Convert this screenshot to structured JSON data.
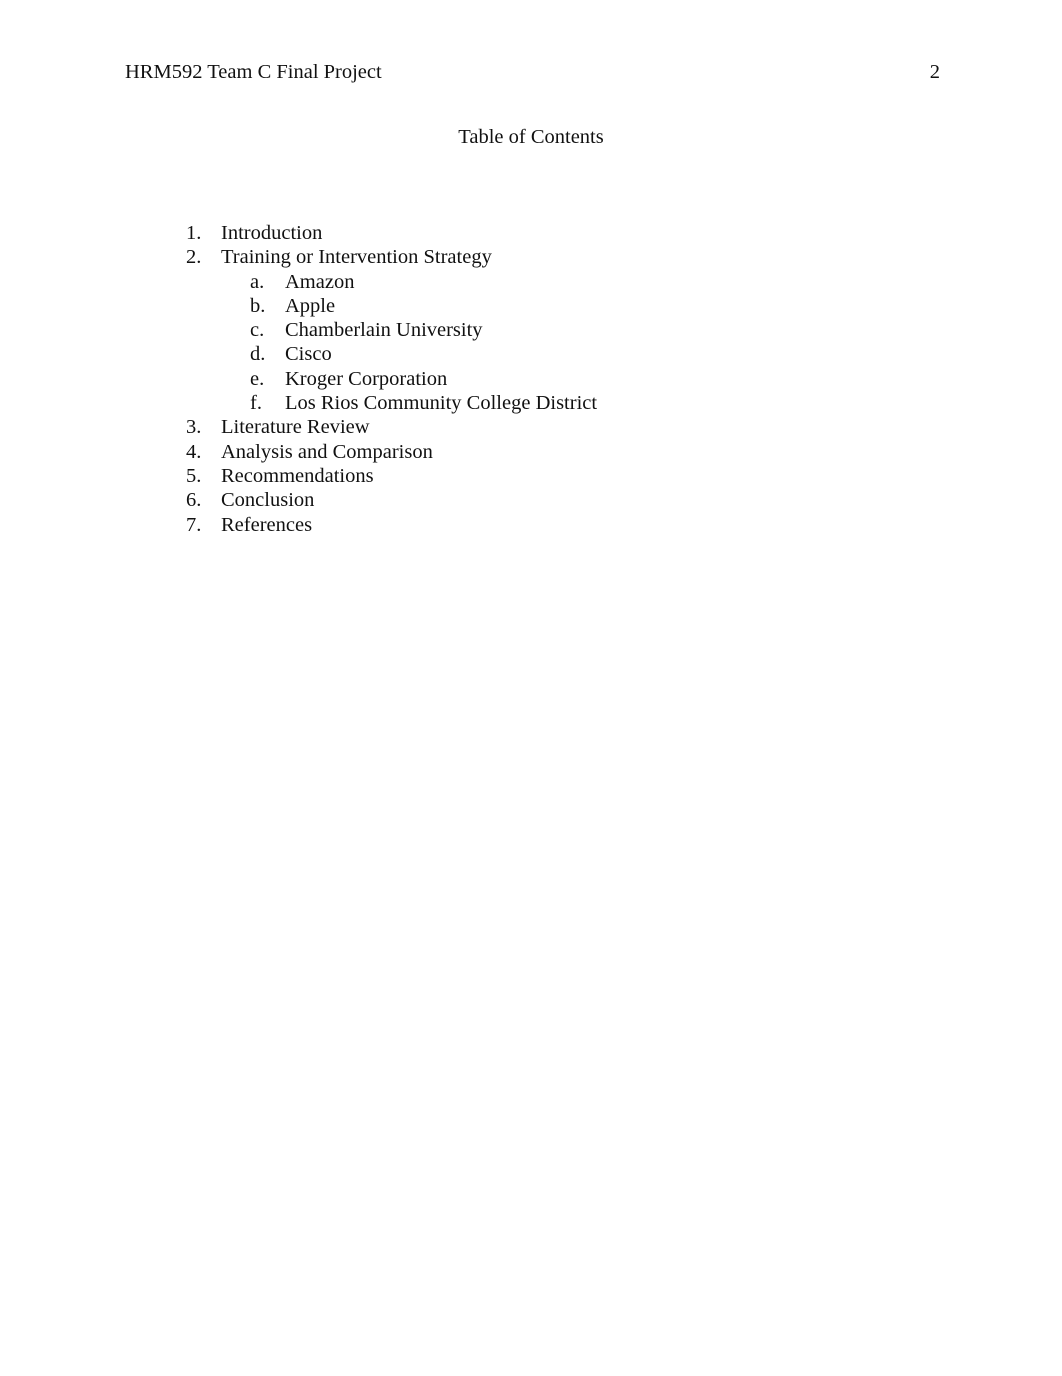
{
  "document": {
    "header": {
      "title": "HRM592 Team C Final Project",
      "page_number": "2"
    },
    "heading": "Table of Contents",
    "toc": {
      "entries": [
        {
          "marker": "1.",
          "label": "Introduction",
          "level": 1
        },
        {
          "marker": "2.",
          "label": "Training or Intervention Strategy",
          "level": 1
        },
        {
          "marker": "a.",
          "label": "Amazon",
          "level": 2
        },
        {
          "marker": "b.",
          "label": "Apple",
          "level": 2
        },
        {
          "marker": "c.",
          "label": "Chamberlain University",
          "level": 2
        },
        {
          "marker": "d.",
          "label": "Cisco",
          "level": 2
        },
        {
          "marker": "e.",
          "label": "Kroger Corporation",
          "level": 2
        },
        {
          "marker": "f.",
          "label": "Los Rios Community College District",
          "level": 2
        },
        {
          "marker": "3.",
          "label": "Literature Review",
          "level": 1
        },
        {
          "marker": "4.",
          "label": "Analysis and Comparison",
          "level": 1
        },
        {
          "marker": "5.",
          "label": "Recommendations",
          "level": 1
        },
        {
          "marker": "6.",
          "label": "Conclusion",
          "level": 1
        },
        {
          "marker": "7.",
          "label": "References",
          "level": 1
        }
      ]
    },
    "colors": {
      "page_background": "#ffffff",
      "text": "#111111"
    }
  }
}
